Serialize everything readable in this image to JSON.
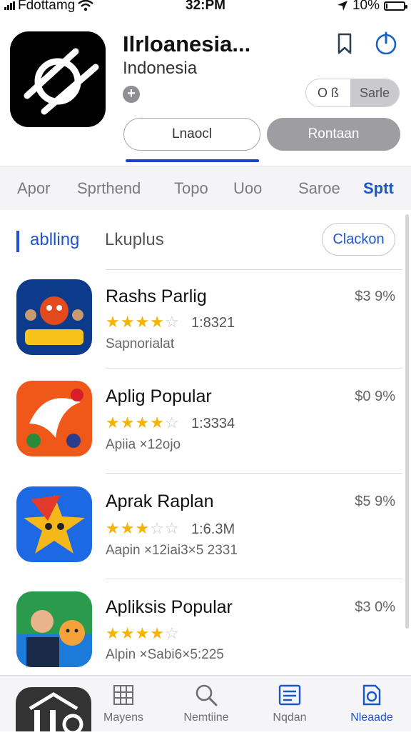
{
  "status_bar": {
    "carrier": "Fdottamg",
    "time": "32:PM",
    "battery": "10%",
    "battery_level": 0.1
  },
  "app": {
    "title": "Ilrloanesia...",
    "subtitle": "Indonesia",
    "segment_left": "O ß",
    "segment_right": "Sarle",
    "button_outline": "Lnaocl",
    "button_filled": "Rontaan"
  },
  "tabs": [
    "Apor",
    "Sprthend",
    "Topo",
    "Uoo",
    "Saroe",
    "Sptt"
  ],
  "section": {
    "title_a": "ablling",
    "title_b": "Lkuplus",
    "button": "Clackon"
  },
  "rows": [
    {
      "name": "Rashs Parlig",
      "price": "$3 9%",
      "rating": 3.5,
      "count": "1:8321",
      "meta": "Sapnorialat",
      "colors": [
        "#0d3b8c",
        "#e34a1e"
      ]
    },
    {
      "name": "Aplig Popular",
      "price": "$0 9%",
      "rating": 4,
      "count": "1:3334",
      "meta": "Apiia ×12ojo",
      "colors": [
        "#f0581a",
        "#d71f2a"
      ]
    },
    {
      "name": "Aprak Raplan",
      "price": "$5 9%",
      "rating": 3,
      "count": "1:6.3M",
      "meta": "Aapin ×12iai3×5 2331",
      "colors": [
        "#1c69e3",
        "#f5b71a"
      ]
    },
    {
      "name": "Apliksis Popular",
      "price": "$3 0%",
      "rating": 4,
      "count": "",
      "meta": "Alpin ×Sabi6×5:225",
      "colors": [
        "#2a9a4c",
        "#f6a23b"
      ]
    }
  ],
  "tabbar": [
    {
      "label": "Mayens",
      "icon": "grid-icon"
    },
    {
      "label": "Nemtiine",
      "icon": "search-icon"
    },
    {
      "label": "Nqdan",
      "icon": "list-icon"
    },
    {
      "label": "Nleaade",
      "icon": "download-icon"
    }
  ]
}
